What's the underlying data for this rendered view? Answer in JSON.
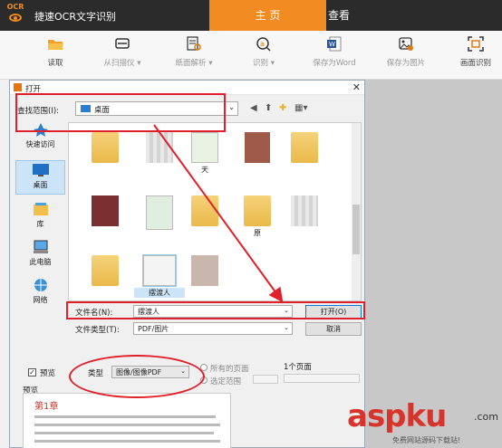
{
  "app": {
    "logo_text": "OCR",
    "title": "捷速OCR文字识别",
    "nav": [
      {
        "label": "主 页",
        "active": true
      },
      {
        "label": "查看",
        "active": false
      }
    ],
    "accent_color": "#f18b22"
  },
  "toolbar": {
    "items": [
      {
        "label": "读取",
        "icon": "folder-open-icon"
      },
      {
        "label": "从扫描仪 ▾",
        "icon": "scanner-icon"
      },
      {
        "label": "纸面解析 ▾",
        "icon": "page-analysis-icon"
      },
      {
        "label": "识别 ▾",
        "icon": "recognize-icon"
      },
      {
        "label": "保存为Word",
        "icon": "word-icon"
      },
      {
        "label": "保存为图片",
        "icon": "save-image-icon"
      },
      {
        "label": "画面识别",
        "icon": "screen-capture-icon"
      }
    ]
  },
  "dialog": {
    "title": "打开",
    "look_in_label": "查找范围(I):",
    "look_in_value": "桌面",
    "places": [
      {
        "label": "快速访问",
        "icon": "pin-icon"
      },
      {
        "label": "桌面",
        "icon": "desktop-icon",
        "selected": true
      },
      {
        "label": "库",
        "icon": "library-icon"
      },
      {
        "label": "此电脑",
        "icon": "computer-icon"
      },
      {
        "label": "网络",
        "icon": "network-icon"
      }
    ],
    "files": [
      {
        "label": ""
      },
      {
        "label": ""
      },
      {
        "label": "天"
      },
      {
        "label": ""
      },
      {
        "label": ""
      },
      {
        "label": ""
      },
      {
        "label": ""
      },
      {
        "label": ""
      },
      {
        "label": "原"
      },
      {
        "label": ""
      },
      {
        "label": ""
      },
      {
        "label": "摆渡人",
        "selected": true
      },
      {
        "label": ""
      }
    ],
    "filename_label": "文件名(N):",
    "filename_value": "摆渡人",
    "filetype_label": "文件类型(T):",
    "filetype_value": "PDF/图片",
    "open_button": "打开(O)",
    "cancel_button": "取消",
    "preview_label": "预览",
    "preview_checked": true,
    "type_label": "类型",
    "type_value": "图像/图像PDF",
    "all_pages": "所有的页面",
    "select_range": "选定范围",
    "page_count": "1个页面",
    "preview_pane_label": "预览",
    "preview_heading": "第1章"
  },
  "watermark": {
    "brand": "aspku",
    "suffix": ".com",
    "tagline": "免费网站源码下载站!"
  }
}
